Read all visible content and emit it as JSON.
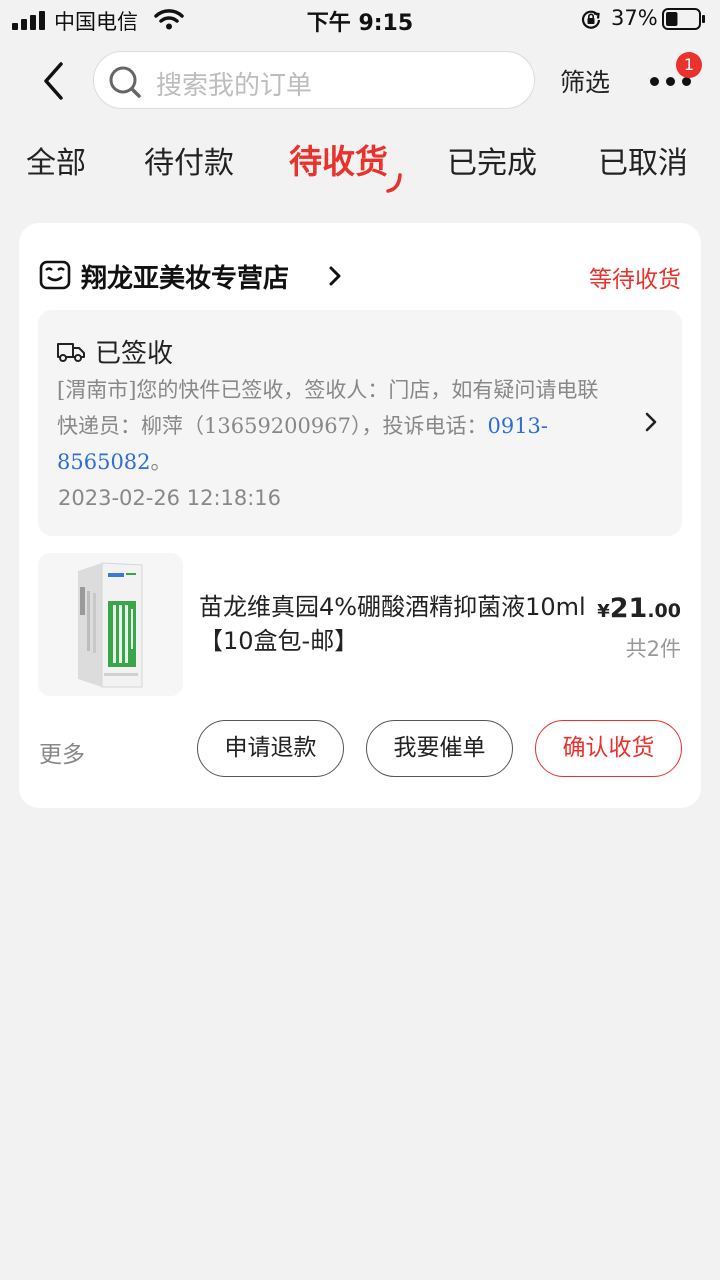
{
  "status_bar": {
    "carrier": "中国电信",
    "time": "下午 9:15",
    "battery": "37%",
    "battery_level": 0.37
  },
  "header": {
    "search_placeholder": "搜索我的订单",
    "filter_label": "筛选",
    "more_badge": "1"
  },
  "tabs": [
    {
      "label": "全部"
    },
    {
      "label": "待付款"
    },
    {
      "label": "待收货",
      "active": true
    },
    {
      "label": "已完成"
    },
    {
      "label": "已取消"
    }
  ],
  "order": {
    "shop_name": "翔龙亚美妆专营店",
    "status": "等待收货",
    "logistics": {
      "title": "已签收",
      "message": "[渭南市]您的快件已签收，签收人：门店，如有疑问请电联快递员：柳萍（13659200967），投诉电话：",
      "complaint_phone": "0913-8565082",
      "message_end": "。",
      "time": "2023-02-26 12:18:16"
    },
    "product": {
      "name": "苗龙维真园4%硼酸酒精抑菌液10ml【10盒包-邮】",
      "price_currency": "¥",
      "price_int": "21",
      "price_dec": ".00",
      "quantity": "共2件"
    },
    "actions": {
      "more": "更多",
      "refund": "申请退款",
      "urge": "我要催单",
      "confirm": "确认收货"
    }
  },
  "colors": {
    "accent": "#e8322b",
    "link": "#2e6fd1",
    "background": "#f2f2f2"
  },
  "icons": [
    "signal-icon",
    "wifi-icon",
    "rotation-lock-icon",
    "battery-icon",
    "back-arrow-icon",
    "search-icon",
    "more-dots-icon",
    "shop-icon",
    "chevron-right-icon",
    "truck-icon"
  ]
}
